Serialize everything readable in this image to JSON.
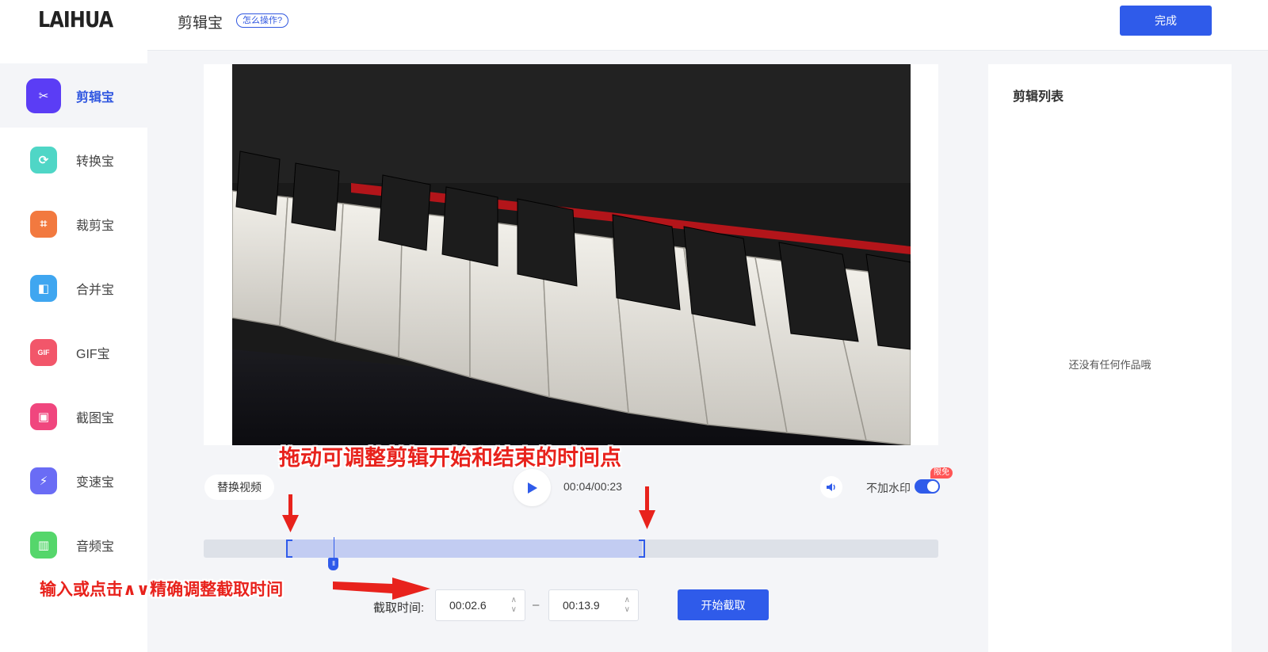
{
  "app": {
    "logo": "LAIHUA"
  },
  "sidebar": {
    "items": [
      {
        "label": "剪辑宝",
        "icon": "scissors-icon",
        "color": "#5b3df5",
        "glyph": "✂",
        "active": true
      },
      {
        "label": "转换宝",
        "icon": "convert-icon",
        "color": "#4fd6c6",
        "glyph": "⟳",
        "active": false
      },
      {
        "label": "裁剪宝",
        "icon": "crop-icon",
        "color": "#f2793f",
        "glyph": "⌗",
        "active": false
      },
      {
        "label": "合并宝",
        "icon": "merge-icon",
        "color": "#3fa6f0",
        "glyph": "◧",
        "active": false
      },
      {
        "label": "GIF宝",
        "icon": "gif-icon",
        "color": "#f2566a",
        "glyph": "GIF",
        "active": false
      },
      {
        "label": "截图宝",
        "icon": "screenshot-icon",
        "color": "#f0467e",
        "glyph": "▣",
        "active": false
      },
      {
        "label": "变速宝",
        "icon": "speed-icon",
        "color": "#6a6cf5",
        "glyph": "⚡",
        "active": false
      },
      {
        "label": "音频宝",
        "icon": "audio-icon",
        "color": "#55d66b",
        "glyph": "▥",
        "active": false
      }
    ]
  },
  "header": {
    "title": "剪辑宝",
    "howto": "怎么操作?",
    "done": "完成"
  },
  "player": {
    "replace_video": "替换视频",
    "timecode": "00:04/00:23",
    "watermark_label": "不加水印",
    "free_badge": "限免",
    "watermark_off": true
  },
  "clip": {
    "label": "截取时间:",
    "start": "00:02.6",
    "end": "00:13.9",
    "dash": "–",
    "start_button": "开始截取"
  },
  "clip_list": {
    "title": "剪辑列表",
    "empty": "还没有任何作品哦"
  },
  "annotations": {
    "top": "拖动可调整剪辑开始和结束的时间点",
    "bottom": "输入或点击∧∨精确调整截取时间"
  },
  "colors": {
    "accent": "#2f5bea",
    "annotation": "#e8221c"
  }
}
